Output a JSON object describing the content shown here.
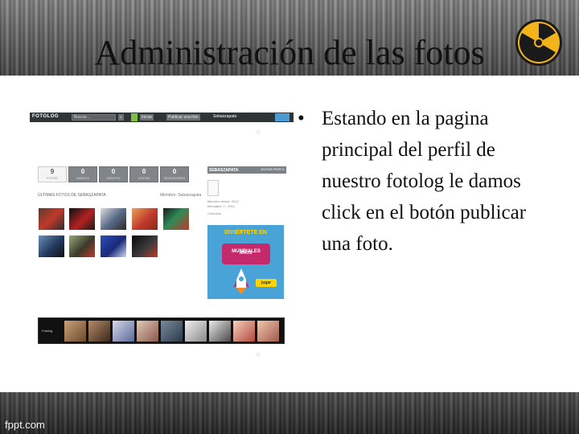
{
  "slide": {
    "title": "Administración de las fotos",
    "bullet": "Estando en la pagina principal del perfil de nuestro fotolog le damos click en el botón publicar una foto.",
    "footer": "fppt.com"
  },
  "screenshot": {
    "nav": {
      "logo": "FOTOLOG",
      "search_placeholder": "Buscar...",
      "buttons": [
        "Iniciar",
        "Publicar una foto"
      ],
      "user": "Sebaszapata"
    },
    "stats": [
      {
        "value": "9",
        "label": "FOTOS"
      },
      {
        "value": "0",
        "label": "AMIGOS"
      },
      {
        "value": "0",
        "label": "GRUPOS"
      },
      {
        "value": "0",
        "label": "VISITAS"
      },
      {
        "value": "0",
        "label": "SEGUIDORES"
      }
    ],
    "photos_heading": "ÚLTIMAS FOTOS DE SEBASZAPATA",
    "member": "Miembro: Sebaszapata",
    "profile": {
      "name": "SEBASZAPATA",
      "action": "EDITAR PERFIL",
      "lines": [
        "Miembro desde: 2012",
        "Mensajes: 9 - 2014",
        "Colombia"
      ]
    },
    "ad": {
      "title": "DIVIÉRTETE EN",
      "badge": "MUNDIALES",
      "kids": "NIÑOS",
      "button": "jugar"
    },
    "strip_label": "Fotolog"
  }
}
